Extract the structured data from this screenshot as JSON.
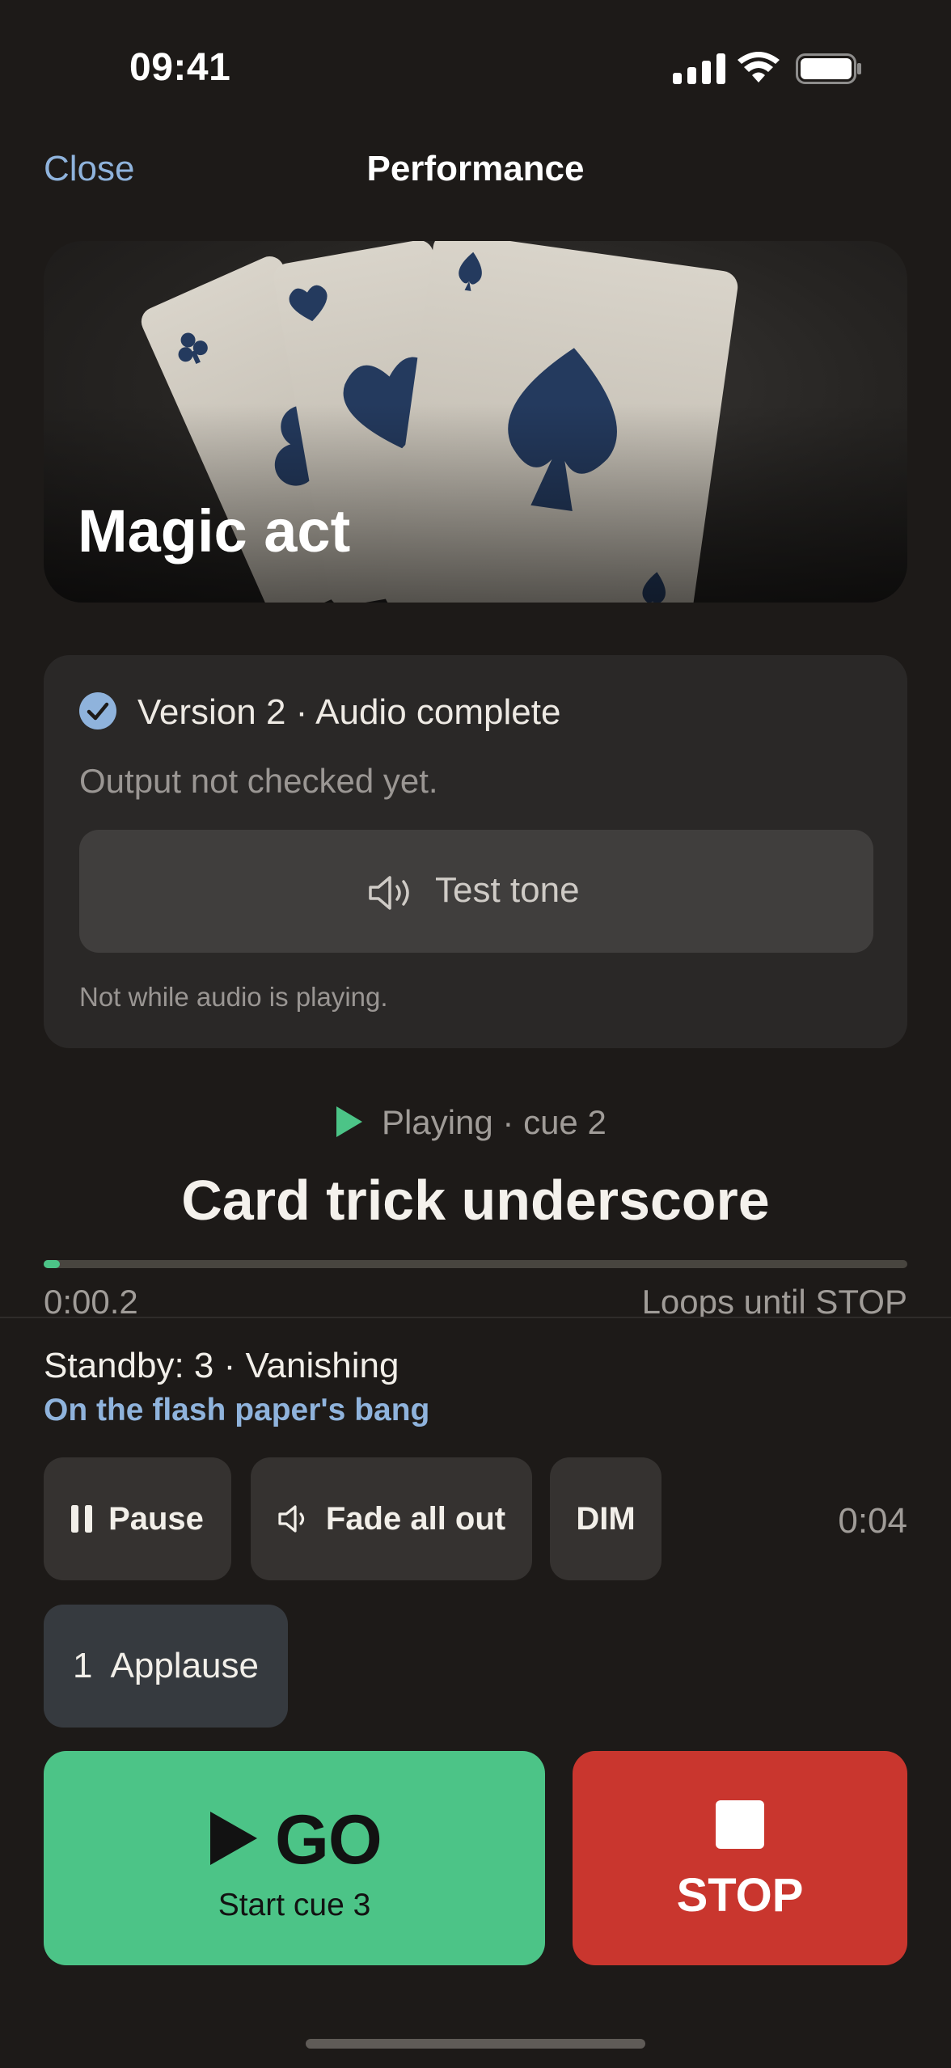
{
  "status_bar": {
    "time": "09:41"
  },
  "nav": {
    "close_label": "Close",
    "title": "Performance"
  },
  "hero": {
    "title": "Magic act"
  },
  "version_card": {
    "version_status": "Version 2 · Audio complete",
    "output_status": "Output not checked yet.",
    "test_tone_label": "Test tone",
    "disabled_note": "Not while audio is playing."
  },
  "now_playing": {
    "status": "Playing · cue 2",
    "title": "Card trick underscore",
    "elapsed": "0:00.2",
    "loop_note": "Loops until STOP",
    "progress_fraction": 0.012
  },
  "standby": {
    "text": "Standby: 3 · Vanishing",
    "note": "On the flash paper's bang"
  },
  "controls": {
    "pause_label": "Pause",
    "fade_label": "Fade all out",
    "dim_label": "DIM",
    "timer": "0:04"
  },
  "hotkeys": [
    {
      "number": "1",
      "label": "Applause"
    }
  ],
  "go": {
    "label": "GO",
    "sub": "Start cue 3"
  },
  "stop": {
    "label": "STOP"
  },
  "colors": {
    "background": "#1d1a18",
    "accent_link": "#8fb3dc",
    "go_green": "#4cc487",
    "stop_red": "#c9362e"
  }
}
